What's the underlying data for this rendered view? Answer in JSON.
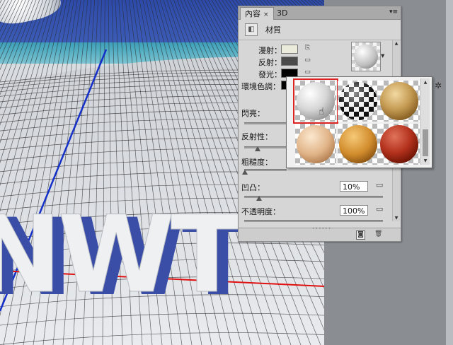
{
  "panel": {
    "tabs": [
      {
        "label": "內容",
        "active": true
      },
      {
        "label": "3D",
        "active": false
      }
    ],
    "close_glyph": "×",
    "menu_glyph": "▾≡",
    "header_title": "材質",
    "header_icon": "material-icon",
    "properties": [
      {
        "label": "漫射：",
        "swatch": "#ebebdc"
      },
      {
        "label": "反射：",
        "swatch": "#4a4a4a"
      },
      {
        "label": "發光：",
        "swatch": "#000000"
      },
      {
        "label": "環境色調：",
        "swatch": "#000000"
      }
    ],
    "sliders": [
      {
        "label": "閃亮："
      },
      {
        "label": "反射性："
      },
      {
        "label": "粗糙度："
      },
      {
        "label": "凹凸：",
        "value": "10%"
      },
      {
        "label": "不透明度：",
        "value": "100%"
      }
    ],
    "footer_icons": [
      "apply-icon",
      "trash-icon"
    ]
  },
  "picker": {
    "materials": [
      {
        "name": "white-marble",
        "selected": true
      },
      {
        "name": "checker"
      },
      {
        "name": "cork"
      },
      {
        "name": "beige-stone"
      },
      {
        "name": "wood"
      },
      {
        "name": "red-leather"
      }
    ],
    "gear_icon": "gear-icon"
  },
  "canvas": {
    "text_3d": "NWT",
    "axis_colors": {
      "x": "#e01010",
      "y": "#1530c8"
    }
  }
}
